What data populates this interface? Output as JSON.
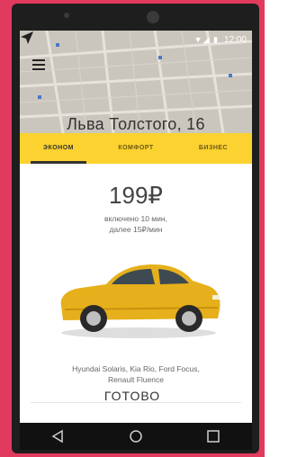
{
  "statusbar": {
    "time": "12:00",
    "icons": "▼◢ ▮"
  },
  "map": {
    "address": "Льва Толстого, 16"
  },
  "tabs": [
    {
      "label": "ЭКОНОМ",
      "active": true
    },
    {
      "label": "КОМФОРТ",
      "active": false
    },
    {
      "label": "БИЗНЕС",
      "active": false
    }
  ],
  "tariff": {
    "price": "199₽",
    "included_line1": "включено 10 мин,",
    "included_line2": "далее 15₽/мин",
    "models_line1": "Hyundai Solaris, Kia Rio, Ford Focus,",
    "models_line2": "Renault Fluence"
  },
  "action": {
    "ready_label": "ГОТОВО"
  },
  "colors": {
    "accent": "#fbd22f",
    "frame": "#e23a5e"
  },
  "icons": {
    "menu": "menu-icon",
    "locate": "navigation-arrow-icon",
    "back": "back-icon",
    "home": "home-icon",
    "recents": "recents-icon"
  }
}
